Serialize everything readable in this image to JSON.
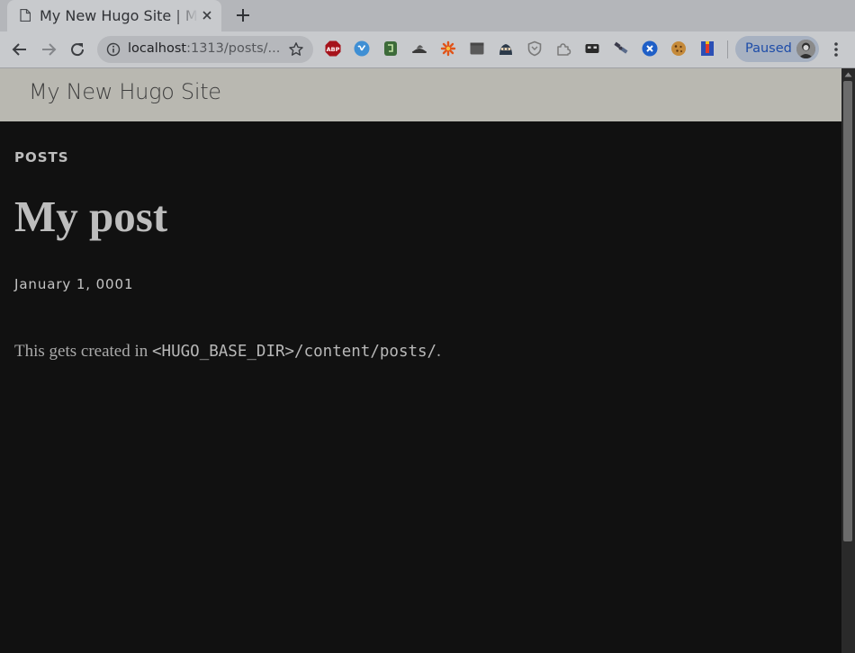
{
  "browser": {
    "tab": {
      "title": "My New Hugo Site | My post",
      "icon": "page-icon",
      "close_icon": "close-icon"
    },
    "new_tab_icon": "plus-icon",
    "toolbar": {
      "back_icon": "arrow-left-icon",
      "forward_icon": "arrow-right-icon",
      "reload_icon": "reload-icon",
      "address": {
        "host": "localhost",
        "path": ":1313/posts/..."
      },
      "bookmark_icon": "star-icon",
      "extensions": [
        {
          "name": "adblock-plus-icon",
          "label": "ABP",
          "color": "#a6131b"
        },
        {
          "name": "vimeo-icon",
          "color": "#3f8fd4"
        },
        {
          "name": "evernote-icon",
          "color": "#3d6b3a"
        },
        {
          "name": "hat-icon",
          "color": "#3a3a3a"
        },
        {
          "name": "flower-icon",
          "color": "#e0541a"
        },
        {
          "name": "folder-icon",
          "color": "#5a5a5a"
        },
        {
          "name": "ninja-icon",
          "color": "#2c3a4a"
        },
        {
          "name": "shield-icon",
          "color": "#7a7a7a"
        },
        {
          "name": "puzzle-icon",
          "color": "#7a7a7a"
        },
        {
          "name": "mask-icon",
          "color": "#2a2a2a"
        },
        {
          "name": "satellite-icon",
          "color": "#3a3a4a"
        },
        {
          "name": "circle-x-icon",
          "color": "#1f5fc7"
        },
        {
          "name": "cookie-icon",
          "color": "#c58a3a"
        },
        {
          "name": "flag-icon",
          "color": "#2b4fb5"
        }
      ],
      "profile": {
        "label": "Paused",
        "avatar_icon": "avatar"
      },
      "menu_icon": "more-vert-icon"
    }
  },
  "page": {
    "site_title": "My New Hugo Site",
    "section": "POSTS",
    "post": {
      "title": "My post",
      "date": "January 1, 0001",
      "body_text_before": "This gets created in ",
      "body_code": "<HUGO_BASE_DIR>/content/posts/",
      "body_text_after": "."
    }
  },
  "colors": {
    "page_background": "#111111",
    "site_header_background": "#b9b8b1",
    "accent_profile": "#1d4ca8"
  }
}
